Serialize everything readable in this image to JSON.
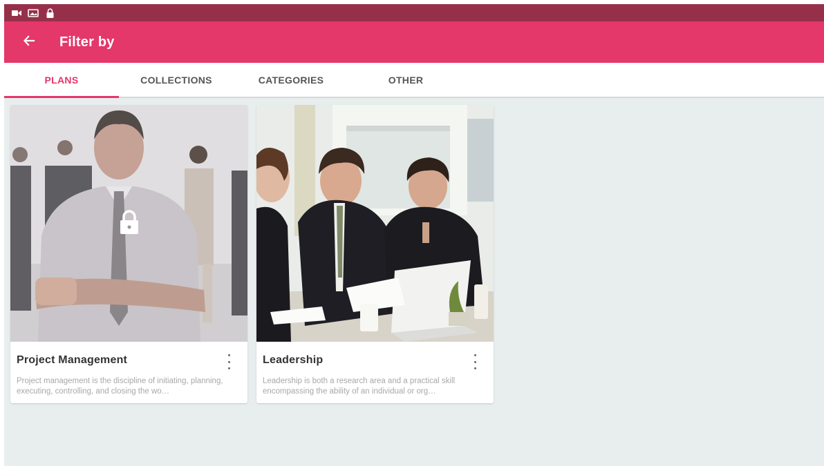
{
  "status_bar": {
    "icons": [
      "video-icon",
      "image-icon",
      "lock-icon"
    ]
  },
  "app_bar": {
    "back_icon": "arrow-left-icon",
    "title": "Filter by"
  },
  "tabs": [
    {
      "label": "PLANS",
      "active": true
    },
    {
      "label": "COLLECTIONS",
      "active": false
    },
    {
      "label": "CATEGORIES",
      "active": false
    },
    {
      "label": "OTHER",
      "active": false
    }
  ],
  "cards": [
    {
      "title": "Project Management",
      "description": "Project management is the discipline of initiating, planning, executing, controlling, and closing the wo…",
      "locked": true,
      "image": "business-people-standing-photo"
    },
    {
      "title": "Leadership",
      "description": "Leadership is both a research area and a practical skill encompassing the ability of an individual or org…",
      "locked": false,
      "image": "business-meeting-photo"
    }
  ],
  "colors": {
    "status_bar": "#96304a",
    "app_bar": "#e4376a",
    "accent": "#e4376a",
    "background": "#e8eeed"
  }
}
